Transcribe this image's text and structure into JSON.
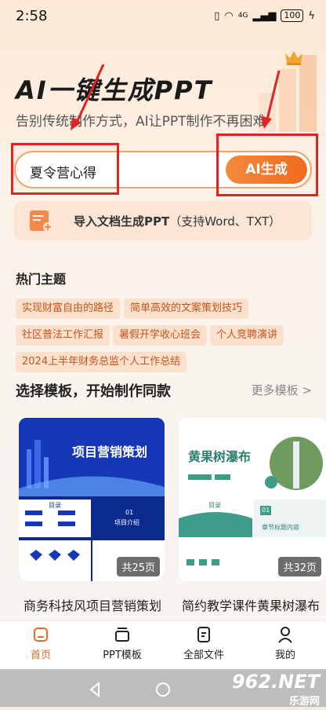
{
  "status": {
    "time": "2:58",
    "battery": "100",
    "signal": "4G"
  },
  "header": {
    "title": "AI一键生成PPT",
    "subtitle": "告别传统制作方式，AI让PPT制作不再困难"
  },
  "input": {
    "value": "夏令营心得",
    "button": "AI生成"
  },
  "import": {
    "label": "导入文档生成PPT",
    "hint": "（支持Word、TXT）"
  },
  "hot": {
    "title": "热门主题",
    "tags": [
      "实现财富自由的路径",
      "简单高效的文案策划技巧",
      "社区普法工作汇报",
      "暑假开学收心班会",
      "个人竞聘演讲",
      "2024上半年财务总监个人工作总结"
    ]
  },
  "templates": {
    "title": "选择模板，开始制作同款",
    "more": "更多模板 >",
    "items": [
      {
        "heading": "项目营销策划",
        "badge": "共25页",
        "caption": "商务科技风项目营销策划",
        "thumb_blocks": [
          "目录",
          "项目介绍",
          "01"
        ]
      },
      {
        "heading": "黄果树瀑布",
        "badge": "共32页",
        "caption": "简约教学课件黄果树瀑布",
        "thumb_blocks": [
          "目录",
          "01",
          "章节标题内容"
        ]
      }
    ]
  },
  "tabs": [
    {
      "label": "首页",
      "icon": "home-icon"
    },
    {
      "label": "PPT模板",
      "icon": "template-icon"
    },
    {
      "label": "全部文件",
      "icon": "file-icon"
    },
    {
      "label": "我的",
      "icon": "user-icon"
    }
  ],
  "watermark": {
    "brand": "962.NET",
    "sub": "乐游网"
  },
  "colors": {
    "accent": "#f06a1f",
    "tag_bg": "#fbe0cc",
    "annotation": "#e32222"
  }
}
